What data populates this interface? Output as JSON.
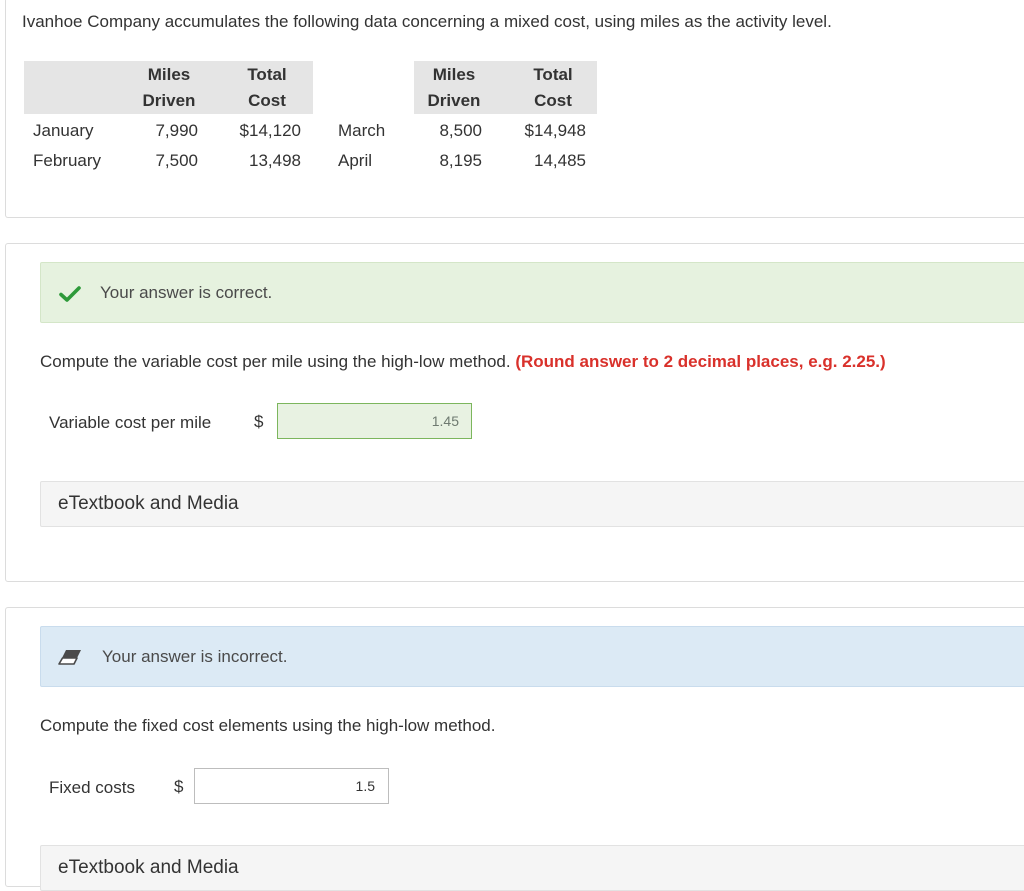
{
  "intro": "Ivanhoe Company accumulates the following data concerning a mixed cost, using miles as the activity level.",
  "table": {
    "headers": {
      "miles_driven_1": [
        "Miles",
        "Driven"
      ],
      "total_cost_1": [
        "Total",
        "Cost"
      ],
      "miles_driven_2": [
        "Miles",
        "Driven"
      ],
      "total_cost_2": [
        "Total",
        "Cost"
      ]
    },
    "rows": [
      {
        "month_a": "January",
        "miles_a": "7,990",
        "cost_a": "$14,120",
        "month_b": "March",
        "miles_b": "8,500",
        "cost_b": "$14,948"
      },
      {
        "month_a": "February",
        "miles_a": "7,500",
        "cost_a": "13,498",
        "month_b": "April",
        "miles_b": "8,195",
        "cost_b": "14,485"
      }
    ]
  },
  "part1": {
    "status": "Your answer is correct.",
    "status_icon": "checkmark-icon",
    "status_color": "#2e9a3a",
    "question": "Compute the variable cost per mile using the high-low method.",
    "rounding_note": "(Round answer to 2 decimal places, e.g. 2.25.)",
    "rounding_color": "#d9312b",
    "field_label": "Variable cost per mile",
    "currency": "$",
    "answer_value": "1.45",
    "etextbook": "eTextbook and Media"
  },
  "part2": {
    "status": "Your answer is incorrect.",
    "status_icon": "eraser-icon",
    "question": "Compute the fixed cost elements using the high-low method.",
    "field_label": "Fixed costs",
    "currency": "$",
    "answer_value": "1.5",
    "etextbook": "eTextbook and Media"
  }
}
